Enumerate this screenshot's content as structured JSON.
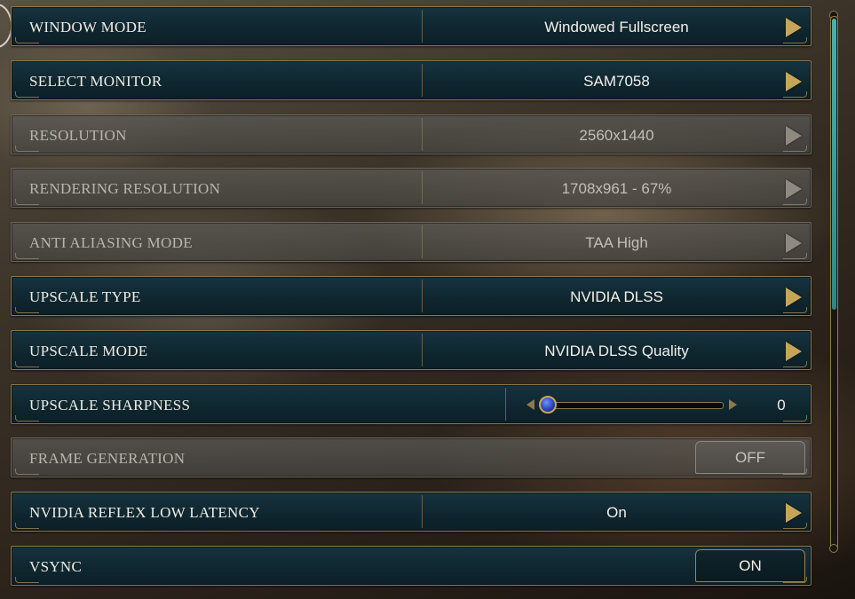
{
  "settings": {
    "rows": [
      {
        "id": "window-mode",
        "label": "WINDOW MODE",
        "value": "Windowed Fullscreen",
        "type": "selector",
        "enabled": true
      },
      {
        "id": "select-monitor",
        "label": "SELECT MONITOR",
        "value": "SAM7058",
        "type": "selector",
        "enabled": true
      },
      {
        "id": "resolution",
        "label": "RESOLUTION",
        "value": "2560x1440",
        "type": "selector",
        "enabled": false
      },
      {
        "id": "rendering-resolution",
        "label": "RENDERING RESOLUTION",
        "value": "1708x961 - 67%",
        "type": "selector",
        "enabled": false
      },
      {
        "id": "anti-aliasing-mode",
        "label": "ANTI ALIASING MODE",
        "value": "TAA High",
        "type": "selector",
        "enabled": false
      },
      {
        "id": "upscale-type",
        "label": "UPSCALE TYPE",
        "value": "NVIDIA DLSS",
        "type": "selector",
        "enabled": true
      },
      {
        "id": "upscale-mode",
        "label": "UPSCALE MODE",
        "value": "NVIDIA DLSS Quality",
        "type": "selector",
        "enabled": true
      },
      {
        "id": "upscale-sharpness",
        "label": "UPSCALE SHARPNESS",
        "value": "0",
        "type": "slider",
        "enabled": true,
        "slider_fraction": 0
      },
      {
        "id": "frame-generation",
        "label": "FRAME GENERATION",
        "value": "OFF",
        "type": "toggle",
        "enabled": false
      },
      {
        "id": "nvidia-reflex",
        "label": "NVIDIA REFLEX LOW LATENCY",
        "value": "On",
        "type": "selector",
        "enabled": true
      },
      {
        "id": "vsync",
        "label": "VSYNC",
        "value": "ON",
        "type": "toggle",
        "enabled": true
      }
    ]
  },
  "scrollbar": {
    "thumb_fraction": 0.55
  },
  "colors": {
    "row_bg": "#0f2730",
    "gold_accent": "#c8a45a",
    "scroll_thumb": "#3a9f9a",
    "slider_knob": "#2a46b8"
  },
  "icons": {
    "selector_next": "chevron-right-icon",
    "slider_left": "chevron-left-icon",
    "slider_right": "chevron-right-icon"
  }
}
